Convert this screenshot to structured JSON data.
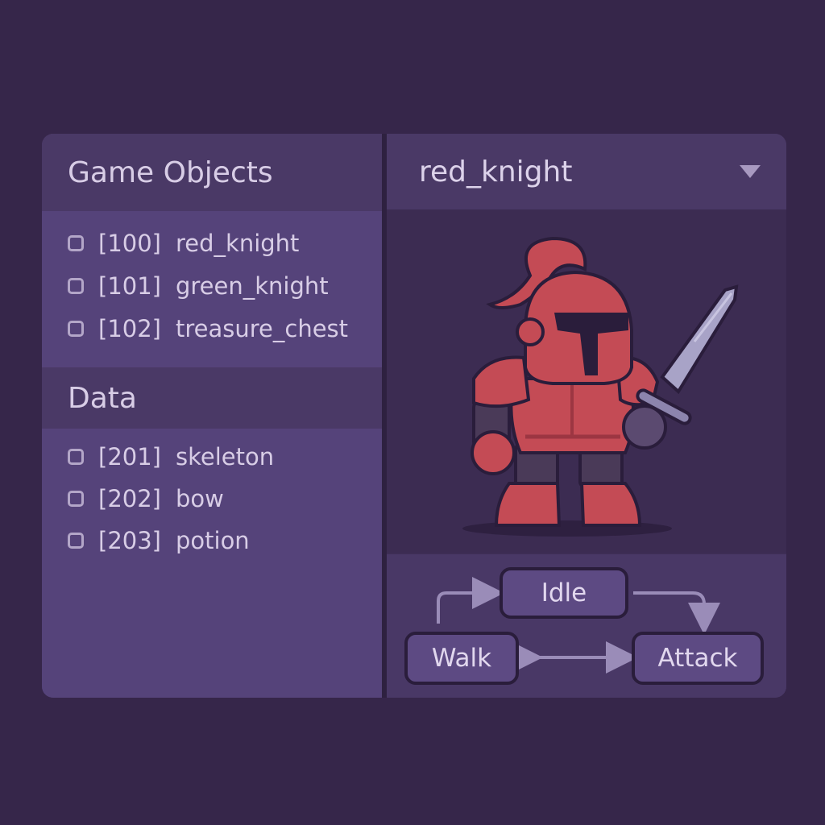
{
  "game_objects": {
    "title": "Game Objects",
    "items": [
      {
        "id": "[100]",
        "name": "red_knight"
      },
      {
        "id": "[101]",
        "name": "green_knight"
      },
      {
        "id": "[102]",
        "name": "treasure_chest"
      }
    ]
  },
  "data_section": {
    "title": "Data",
    "items": [
      {
        "id": "[201]",
        "name": "skeleton"
      },
      {
        "id": "[202]",
        "name": "bow"
      },
      {
        "id": "[203]",
        "name": "potion"
      }
    ]
  },
  "selected_object": {
    "name": "red_knight",
    "dropdown_icon": "chevron-down-icon"
  },
  "state_machine": {
    "states": [
      "Idle",
      "Walk",
      "Attack"
    ]
  },
  "colors": {
    "background": "#36264a",
    "panel": "#4b3a67",
    "knight_red": "#c44b55",
    "sword": "#a8a3c7"
  }
}
